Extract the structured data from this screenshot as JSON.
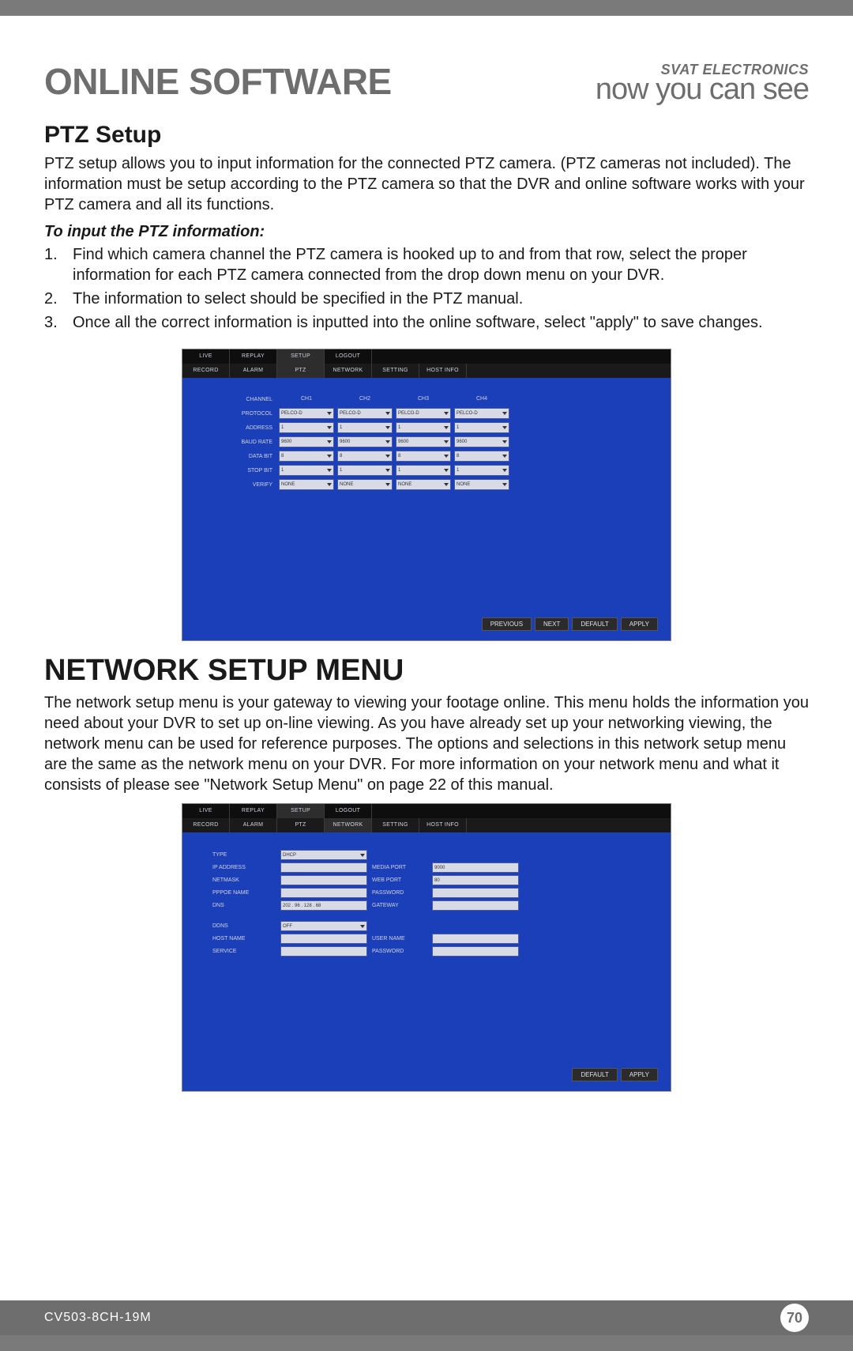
{
  "header": {
    "title": "ONLINE SOFTWARE",
    "brand_small": "SVAT ELECTRONICS",
    "brand_tag": "now you can see"
  },
  "ptz": {
    "heading": "PTZ Setup",
    "intro": "PTZ setup allows you to input information for the connected PTZ camera. (PTZ cameras not included). The information must be setup according to the PTZ camera so that the DVR and online software works with your PTZ camera and all its functions.",
    "sub": "To input the PTZ information:",
    "steps": [
      "Find which camera channel the PTZ camera is hooked up to and from that row, select the proper information for each PTZ camera connected from the drop down menu on your DVR.",
      "The information to select should be specified in the PTZ manual.",
      "Once all the correct information is inputted into the online software, select \"apply\" to save changes."
    ],
    "shot": {
      "top_tabs": [
        "LIVE",
        "REPLAY",
        "SETUP",
        "LOGOUT"
      ],
      "sub_tabs": [
        "RECORD",
        "ALARM",
        "PTZ",
        "NETWORK",
        "SETTING",
        "HOST INFO"
      ],
      "col_headers": [
        "CH1",
        "CH2",
        "CH3",
        "CH4"
      ],
      "rows": [
        {
          "label": "CHANNEL",
          "vals": [
            "",
            "",
            "",
            ""
          ]
        },
        {
          "label": "PROTOCOL",
          "vals": [
            "PELCO-D",
            "PELCO-D",
            "PELCO-D",
            "PELCO-D"
          ]
        },
        {
          "label": "ADDRESS",
          "vals": [
            "1",
            "1",
            "1",
            "1"
          ]
        },
        {
          "label": "BAUD RATE",
          "vals": [
            "9600",
            "9600",
            "9600",
            "9600"
          ]
        },
        {
          "label": "DATA BIT",
          "vals": [
            "8",
            "8",
            "8",
            "8"
          ]
        },
        {
          "label": "STOP BIT",
          "vals": [
            "1",
            "1",
            "1",
            "1"
          ]
        },
        {
          "label": "VERIFY",
          "vals": [
            "NONE",
            "NONE",
            "NONE",
            "NONE"
          ]
        }
      ],
      "buttons": [
        "PREVIOUS",
        "NEXT",
        "DEFAULT",
        "APPLY"
      ]
    }
  },
  "network": {
    "heading": "NETWORK SETUP MENU",
    "intro": "The network setup menu is your gateway to viewing your footage online. This menu holds the information you need about your DVR to set up on-line viewing. As you have already set up your networking viewing, the network menu can be used for reference purposes. The options and selections in this network setup menu are the same as the network menu on your DVR. For more information on your network menu and what it consists of please see \"Network Setup Menu\" on page 22 of this manual.",
    "shot": {
      "top_tabs": [
        "LIVE",
        "REPLAY",
        "SETUP",
        "LOGOUT"
      ],
      "sub_tabs": [
        "RECORD",
        "ALARM",
        "PTZ",
        "NETWORK",
        "SETTING",
        "HOST INFO"
      ],
      "fields": {
        "type_label": "TYPE",
        "type_val": "DHCP",
        "ip_label": "IP ADDRESS",
        "ip_val": "",
        "media_label": "MEDIA PORT",
        "media_val": "9000",
        "netmask_label": "NETMASK",
        "netmask_val": "",
        "web_label": "WEB PORT",
        "web_val": "80",
        "pppoe_label": "PPPOE NAME",
        "pppoe_val": "",
        "pwd_label": "PASSWORD",
        "pwd_val": "",
        "dns_label": "DNS",
        "dns_val": "202 . 96 . 128 . 68",
        "gw_label": "GATEWAY",
        "gw_val": "",
        "ddns_label": "DDNS",
        "ddns_val": "OFF",
        "host_label": "HOST NAME",
        "host_val": "",
        "user_label": "USER NAME",
        "user_val": "",
        "service_label": "SERVICE",
        "service_val": "",
        "pwd2_label": "PASSWORD",
        "pwd2_val": ""
      },
      "buttons": [
        "DEFAULT",
        "APPLY"
      ]
    }
  },
  "footer": {
    "model": "CV503-8CH-19M",
    "page": "70"
  }
}
